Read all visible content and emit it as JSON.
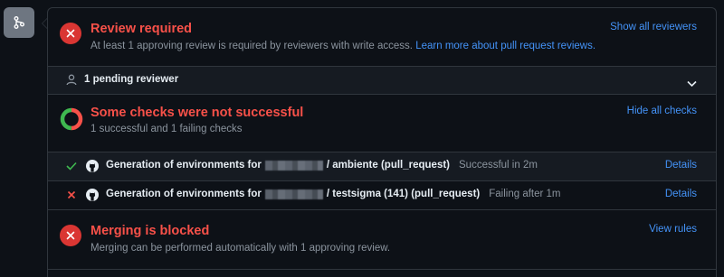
{
  "review": {
    "title": "Review required",
    "description": "At least 1 approving review is required by reviewers with write access.",
    "learn_more_link": "Learn more about pull request reviews.",
    "show_all_link": "Show all reviewers"
  },
  "pending": {
    "label": "1 pending reviewer"
  },
  "checks": {
    "title": "Some checks were not successful",
    "summary": "1 successful and 1 failing checks",
    "hide_all_link": "Hide all checks",
    "rows": [
      {
        "status": "success",
        "prefix": "Generation of environments for",
        "suffix": "/ ambiente (pull_request)",
        "meta": "Successful in 2m",
        "details": "Details"
      },
      {
        "status": "failure",
        "prefix": "Generation of environments for",
        "suffix": "/ testsigma (141) (pull_request)",
        "meta": "Failing after 1m",
        "details": "Details"
      }
    ]
  },
  "merge": {
    "title": "Merging is blocked",
    "description": "Merging can be performed automatically with 1 approving review.",
    "view_rules_link": "View rules"
  },
  "colors": {
    "danger": "#f85149",
    "success": "#3fb950",
    "link": "#4493f8",
    "background": "#0d1117"
  },
  "icons": {
    "merge": "git-merge-icon",
    "x": "x-circle-icon",
    "person": "person-icon",
    "chevron": "chevron-down-icon",
    "check": "check-icon",
    "github": "github-mark-icon",
    "donut": "checks-donut-icon"
  }
}
